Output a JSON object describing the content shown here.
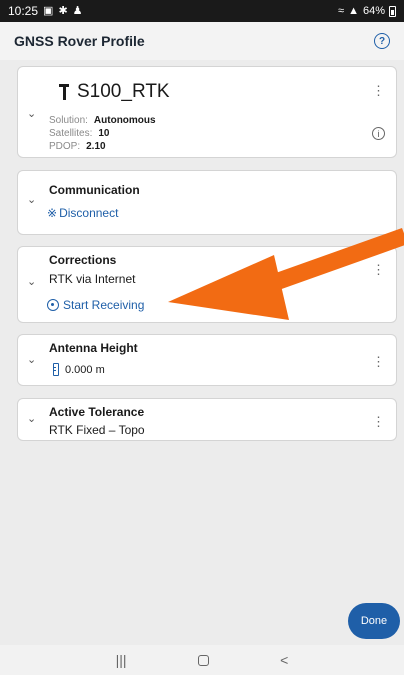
{
  "status_bar": {
    "time": "10:25",
    "battery": "64%"
  },
  "header": {
    "title": "GNSS Rover Profile",
    "help_icon": "help-circle-icon"
  },
  "receiver": {
    "name": "S100_RTK",
    "solution_label": "Solution:",
    "solution_value": "Autonomous",
    "satellites_label": "Satellites:",
    "satellites_value": "10",
    "pdop_label": "PDOP:",
    "pdop_value": "2.10"
  },
  "communication": {
    "title": "Communication",
    "action": "Disconnect"
  },
  "corrections": {
    "title": "Corrections",
    "source": "RTK via Internet",
    "action": "Start Receiving"
  },
  "antenna": {
    "title": "Antenna Height",
    "value": "0.000 m"
  },
  "tolerance": {
    "title": "Active Tolerance",
    "value": "RTK Fixed – Topo"
  },
  "done_label": "Done",
  "colors": {
    "accent": "#1f5fa8",
    "annotation_arrow": "#f26b13",
    "status_bar": "#1a1a1a",
    "background": "#ececec"
  }
}
